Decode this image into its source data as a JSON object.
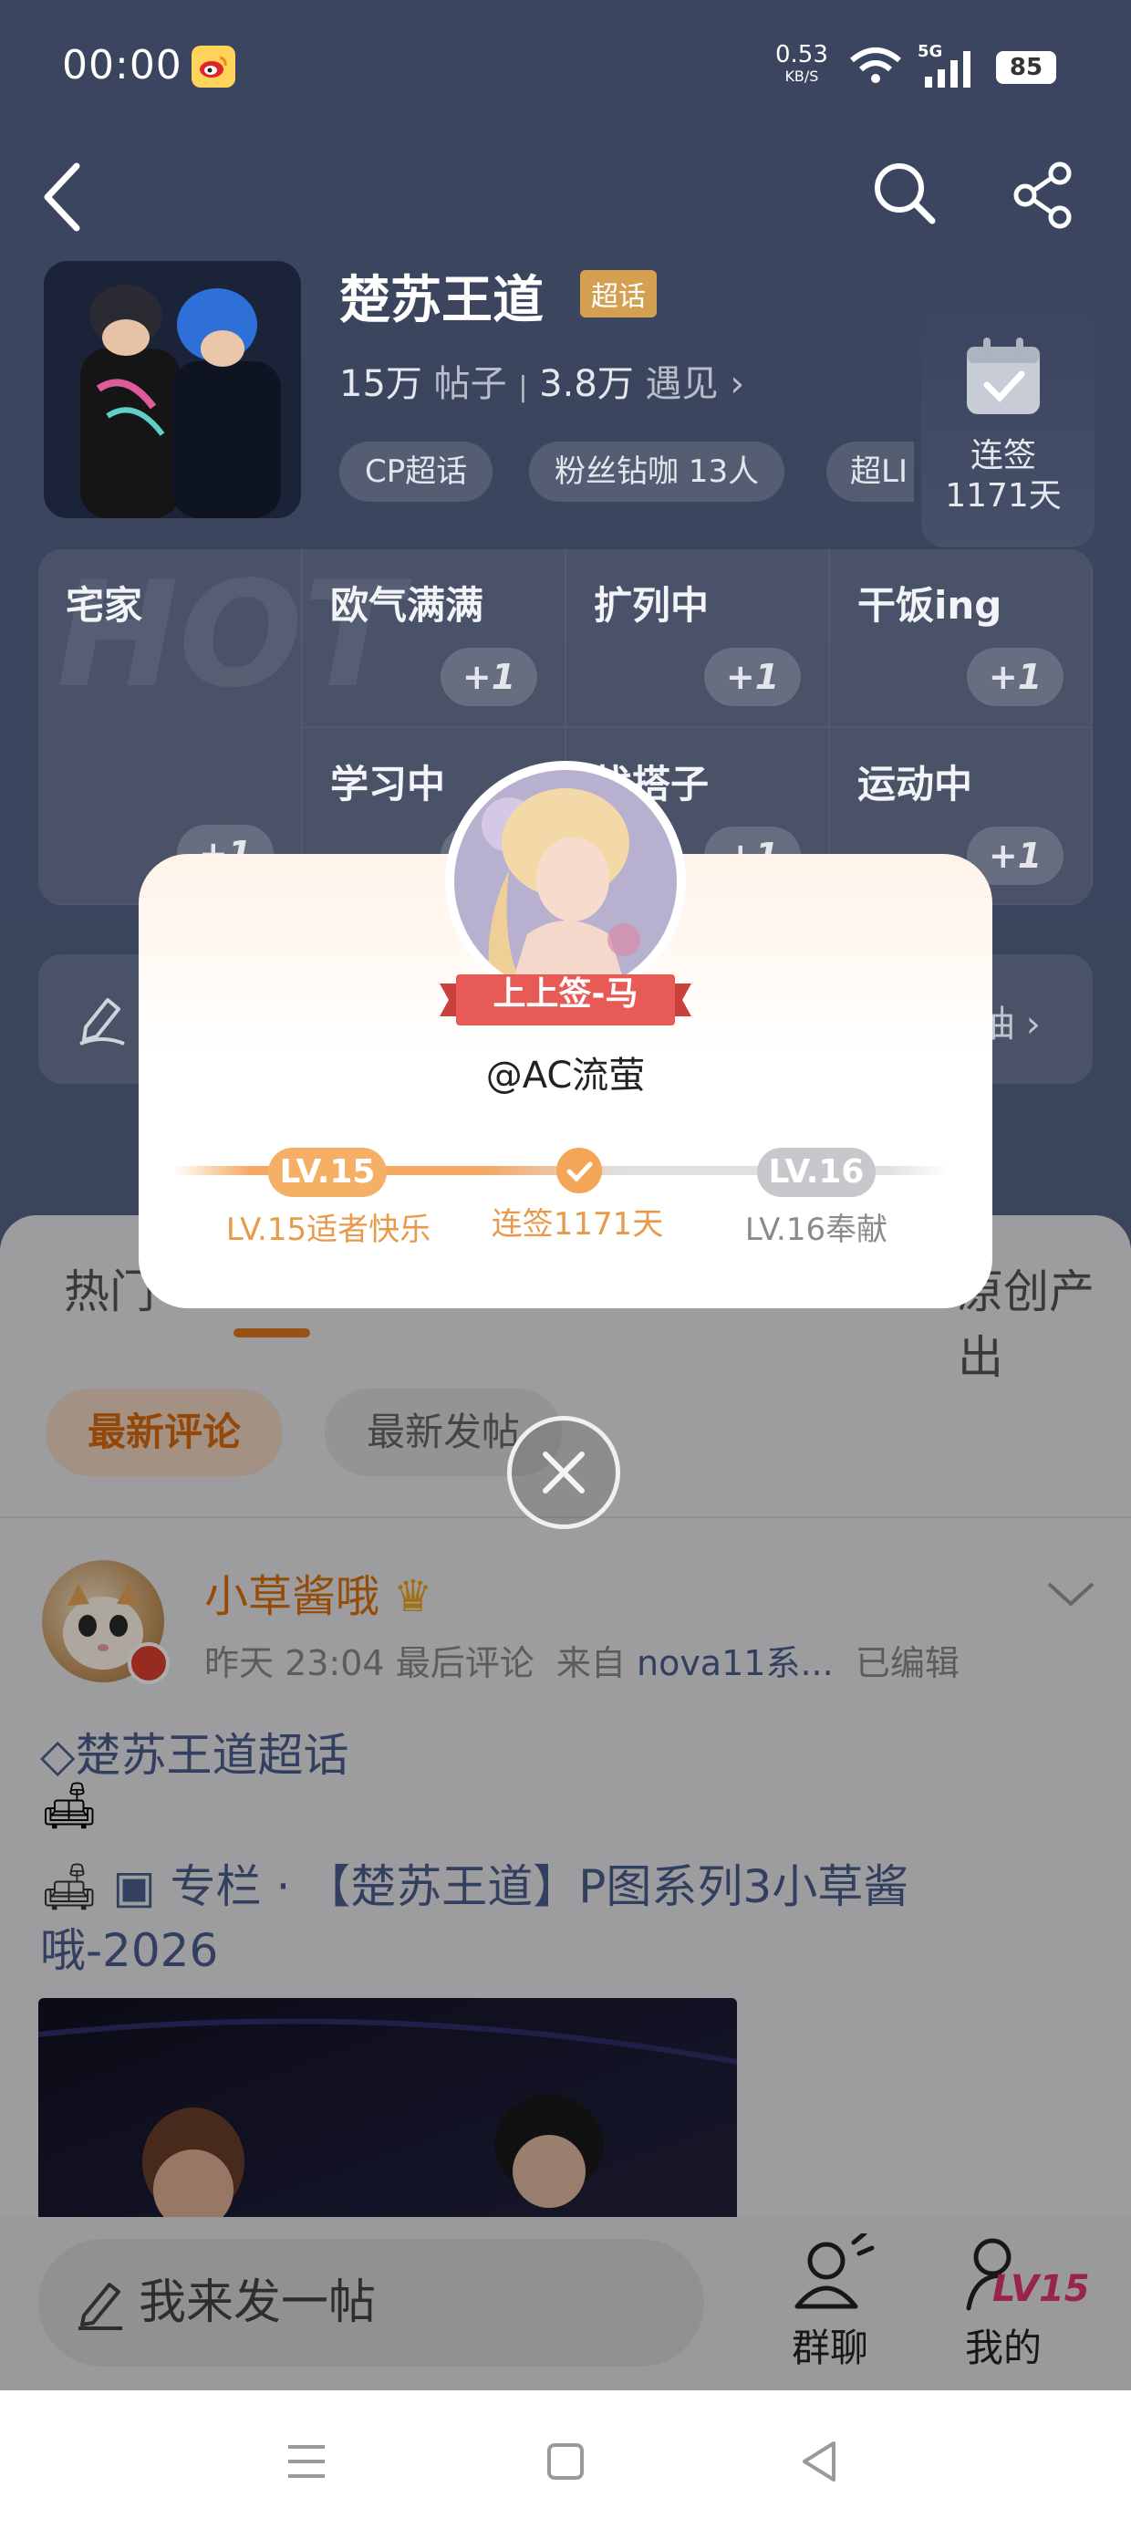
{
  "status_bar": {
    "time": "00:00",
    "net_speed": "0.53",
    "net_unit": "KB/S",
    "signal": "5G",
    "battery": "85"
  },
  "header": {
    "title": "楚苏王道",
    "badge": "超话",
    "posts_count": "15万",
    "posts_label": "帖子",
    "meet_count": "3.8万",
    "meet_label": "遇见",
    "tags": [
      "CP超话",
      "粉丝钻咖 13人",
      "超LI"
    ],
    "sign_label": "连签",
    "sign_days": "1171天"
  },
  "mood_grid": {
    "hot_watermark": "HOT",
    "cells": [
      {
        "label": "宅家"
      },
      {
        "label": "欧气满满",
        "plus": "+1"
      },
      {
        "label": "扩列中",
        "plus": "+1"
      },
      {
        "label": "干饭ing",
        "plus": "+1"
      },
      {
        "label": "学习中",
        "plus": "+1"
      },
      {
        "label": "找搭子",
        "plus": "+1"
      },
      {
        "label": "运动中",
        "plus": "+1"
      }
    ],
    "first_plus": "+1"
  },
  "task_row": {
    "right_text": "抽"
  },
  "tabs": {
    "left": "热门",
    "right": "原创产出"
  },
  "filters": {
    "latest_comment": "最新评论",
    "latest_post": "最新发帖"
  },
  "post": {
    "username": "小草酱哦",
    "time": "昨天 23:04",
    "activity": "最后评论",
    "source_prefix": "来自",
    "source": "nova11系...",
    "edited": "已编辑",
    "topic": "楚苏王道超话",
    "column_prefix": "专栏 ·",
    "column_title_l1": "【楚苏王道】P图系列3小草酱",
    "column_title_l2": "哦-2026"
  },
  "bottom_bar": {
    "compose_placeholder": "我来发一帖",
    "group_chat": "群聊",
    "mine": "我的",
    "level_badge": "LV15"
  },
  "popup": {
    "ribbon": "上上签-马",
    "handle": "@AC流萤",
    "current_level": "LV.15",
    "current_caption": "LV.15适者快乐",
    "streak": "连签1171天",
    "next_level": "LV.16",
    "next_caption": "LV.16奉献"
  },
  "colors": {
    "accent": "#e07a1f",
    "popup_orange": "#f4a862",
    "ribbon_red": "#e85a55",
    "header_bg": "#3b4560"
  }
}
